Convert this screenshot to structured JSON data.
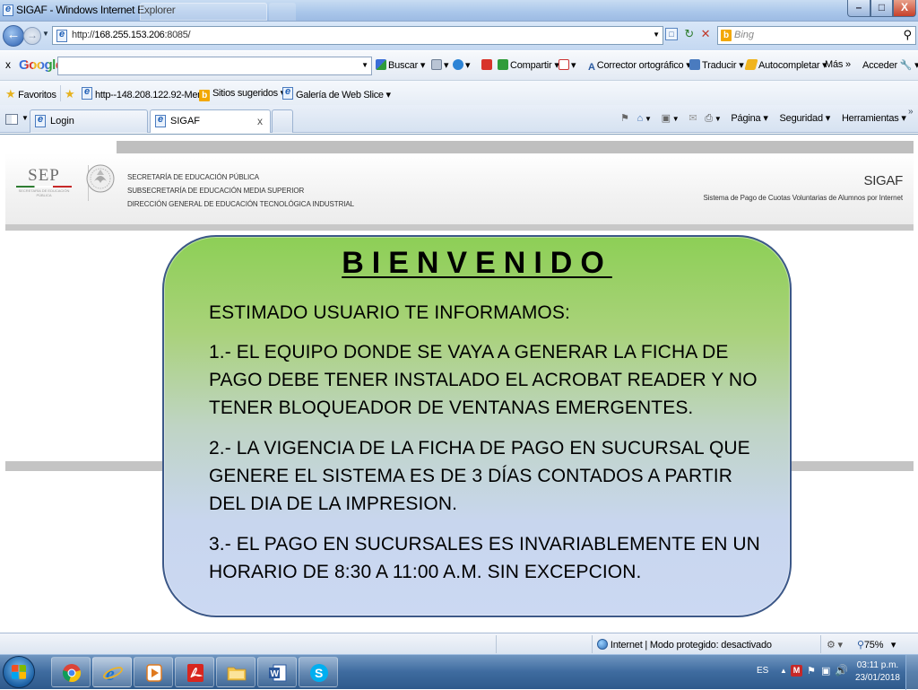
{
  "window": {
    "title": "SIGAF - Windows Internet Explorer",
    "min": "–",
    "max": "□",
    "close": "X"
  },
  "address": {
    "prefix": "http://",
    "host": "168.255.153.206",
    "suffix": ":8085/",
    "search_placeholder": "Bing"
  },
  "google_toolbar": {
    "close": "x",
    "logo": "Google",
    "buscar": "Buscar",
    "compartir": "Compartir",
    "corrector": "Corrector ortográfico",
    "traducir": "Traducir",
    "autocompletar": "Autocompletar",
    "mas": "Más »",
    "acceder": "Acceder"
  },
  "favorites": {
    "label": "Favoritos",
    "items": [
      "http--148.208.122.92-Men...",
      "Sitios sugeridos",
      "Galería de Web Slice"
    ]
  },
  "tabs": {
    "login": "Login",
    "sigaf": "SIGAF",
    "close": "x"
  },
  "command_bar": {
    "pagina": "Página",
    "seguridad": "Seguridad",
    "herramientas": "Herramientas"
  },
  "header": {
    "sep_logo": "SEP",
    "sep_small": "SECRETARÍA DE EDUCACIÓN PÚBLICA",
    "dept_lines": [
      "SECRETARÍA DE EDUCACIÓN PÚBLICA",
      "SUBSECRETARÍA DE EDUCACIÓN MEDIA SUPERIOR",
      "DIRECCIÓN GENERAL DE EDUCACIÓN TECNOLÓGICA INDUSTRIAL"
    ],
    "app_name": "SIGAF",
    "app_subtitle": "Sistema de Pago de Cuotas Voluntarias de Alumnos por Internet"
  },
  "welcome": {
    "title": "BIENVENIDO",
    "intro": "ESTIMADO USUARIO TE INFORMAMOS:",
    "points": [
      "1.- EL EQUIPO DONDE SE VAYA A GENERAR LA FICHA DE PAGO DEBE TENER INSTALADO EL ACROBAT READER Y NO TENER BLOQUEADOR DE VENTANAS EMERGENTES.",
      "2.- LA VIGENCIA DE LA FICHA DE PAGO EN SUCURSAL QUE GENERE EL SISTEMA ES DE 3 DÍAS CONTADOS A PARTIR DEL DIA DE LA IMPRESION.",
      "3.- EL PAGO EN SUCURSALES ES INVARIABLEMENTE EN UN HORARIO DE 8:30 A 11:00 A.M. SIN EXCEPCION."
    ]
  },
  "status": {
    "zone": "Internet | Modo protegido: desactivado",
    "zoom": "75%"
  },
  "taskbar": {
    "apps": [
      "chrome-icon",
      "internet-explorer-icon",
      "media-player-icon",
      "acrobat-icon",
      "folder-icon",
      "word-icon",
      "skype-icon"
    ],
    "lang": "ES",
    "time": "03:11 p.m.",
    "date": "23/01/2018"
  },
  "colors": {
    "panel_top": "#8dcf56",
    "panel_bottom": "#cbd8f2",
    "panel_border": "#3c5888",
    "taskbar": "#3e6b9f"
  }
}
